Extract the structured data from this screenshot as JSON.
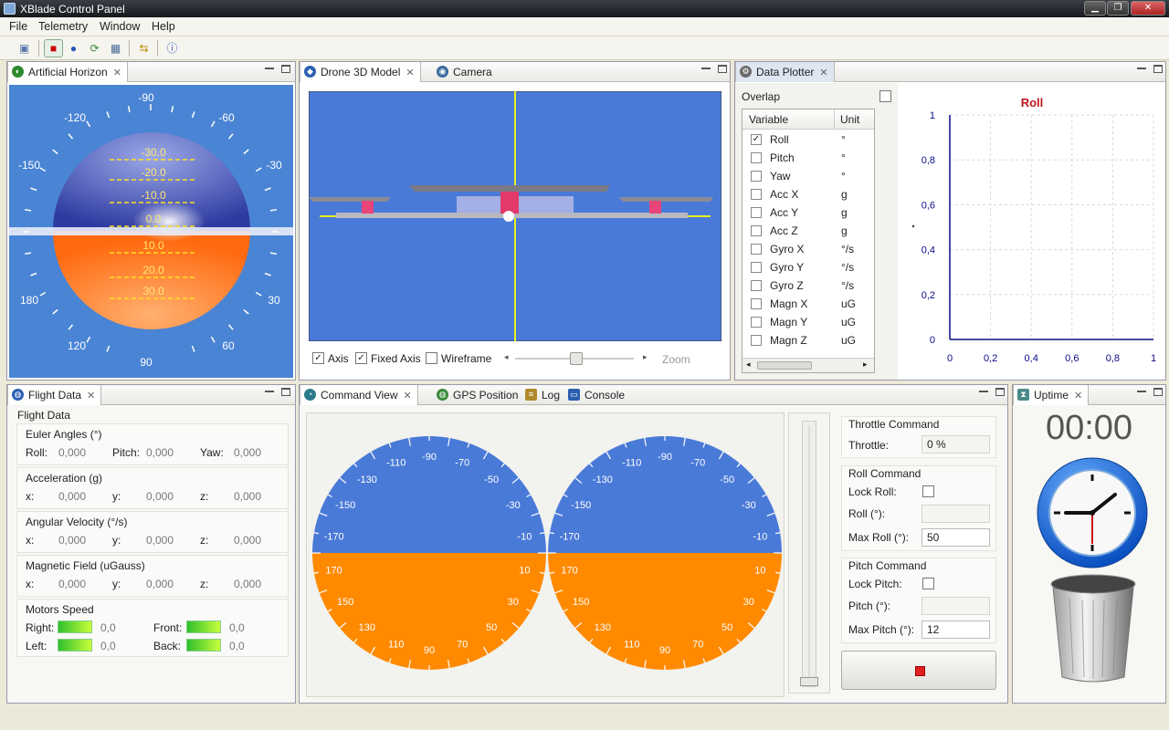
{
  "window": {
    "title": "XBlade Control Panel",
    "minimize": "▁",
    "maximize": "❐",
    "close": "✕"
  },
  "menu": [
    "File",
    "Telemetry",
    "Window",
    "Help"
  ],
  "panels": {
    "horizon": {
      "tab": "Artificial Horizon",
      "pitch_labels": [
        "-30.0",
        "-20.0",
        "-10.0",
        "0.0",
        "10.0",
        "20.0",
        "30.0"
      ],
      "roll_labels": [
        "-90",
        "-120",
        "-60",
        "-150",
        "-30",
        "180",
        "30",
        "120",
        "60",
        "90"
      ]
    },
    "model": {
      "tabs": [
        "Drone 3D Model",
        "Camera"
      ],
      "axis": "Axis",
      "fixed_axis": "Fixed Axis",
      "wireframe": "Wireframe",
      "zoom": "Zoom"
    },
    "plotter": {
      "tab": "Data Plotter",
      "overlap": "Overlap",
      "col_variable": "Variable",
      "col_unit": "Unit",
      "variables": [
        {
          "name": "Roll",
          "unit": "°",
          "checked": true
        },
        {
          "name": "Pitch",
          "unit": "°",
          "checked": false
        },
        {
          "name": "Yaw",
          "unit": "°",
          "checked": false
        },
        {
          "name": "Acc X",
          "unit": "g",
          "checked": false
        },
        {
          "name": "Acc Y",
          "unit": "g",
          "checked": false
        },
        {
          "name": "Acc Z",
          "unit": "g",
          "checked": false
        },
        {
          "name": "Gyro X",
          "unit": "°/s",
          "checked": false
        },
        {
          "name": "Gyro Y",
          "unit": "°/s",
          "checked": false
        },
        {
          "name": "Gyro Z",
          "unit": "°/s",
          "checked": false
        },
        {
          "name": "Magn X",
          "unit": "uG",
          "checked": false
        },
        {
          "name": "Magn Y",
          "unit": "uG",
          "checked": false
        },
        {
          "name": "Magn Z",
          "unit": "uG",
          "checked": false
        }
      ],
      "chart_title": "Roll",
      "y_ticks": [
        "0",
        "0,2",
        "0,4",
        "0,6",
        "0,8",
        "1"
      ],
      "x_ticks": [
        "0",
        "0,2",
        "0,4",
        "0,6",
        "0,8",
        "1"
      ]
    },
    "flight": {
      "tab": "Flight Data",
      "header": "Flight Data",
      "euler": {
        "title": "Euler Angles (°)",
        "roll": "Roll:",
        "roll_v": "0,000",
        "pitch": "Pitch:",
        "pitch_v": "0,000",
        "yaw": "Yaw:",
        "yaw_v": "0,000"
      },
      "accel": {
        "title": "Acceleration (g)",
        "x": "x:",
        "x_v": "0,000",
        "y": "y:",
        "y_v": "0,000",
        "z": "z:",
        "z_v": "0,000"
      },
      "gyro": {
        "title": "Angular Velocity (°/s)",
        "x": "x:",
        "x_v": "0,000",
        "y": "y:",
        "y_v": "0,000",
        "z": "z:",
        "z_v": "0,000"
      },
      "mag": {
        "title": "Magnetic Field (uGauss)",
        "x": "x:",
        "x_v": "0,000",
        "y": "y:",
        "y_v": "0,000",
        "z": "z:",
        "z_v": "0,000"
      },
      "motors": {
        "title": "Motors Speed",
        "right": "Right:",
        "right_v": "0,0",
        "front": "Front:",
        "front_v": "0,0",
        "left": "Left:",
        "left_v": "0,0",
        "back": "Back:",
        "back_v": "0,0"
      }
    },
    "command": {
      "tabs": [
        "Command View",
        "GPS Position",
        "Log",
        "Console"
      ],
      "dial_top": [
        "-90",
        "-110",
        "-70",
        "-130",
        "-50",
        "-150",
        "-30",
        "-170",
        "-10"
      ],
      "dial_bottom": [
        "170",
        "10",
        "150",
        "30",
        "130",
        "50",
        "110",
        "70",
        "90"
      ],
      "throttle_group": "Throttle Command",
      "throttle_lbl": "Throttle:",
      "throttle_v": "0 %",
      "roll_group": "Roll Command",
      "lock_roll": "Lock Roll:",
      "roll_lbl": "Roll (°):",
      "max_roll_lbl": "Max Roll (°):",
      "max_roll_v": "50",
      "pitch_group": "Pitch Command",
      "lock_pitch": "Lock Pitch:",
      "pitch_lbl": "Pitch (°):",
      "max_pitch_lbl": "Max Pitch (°):",
      "max_pitch_v": "12"
    },
    "uptime": {
      "tab": "Uptime",
      "time": "00:00"
    }
  },
  "colors": {
    "sky": "#4a7ad8",
    "ground": "#ff8a00",
    "horizon_bg": "#4a84d4",
    "plot_line": "#0b0b8a",
    "title_red": "#c0161c"
  }
}
